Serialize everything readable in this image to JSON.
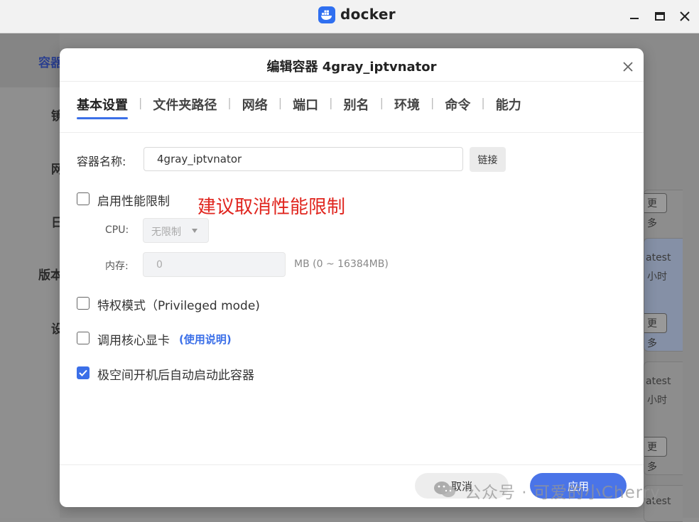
{
  "window": {
    "title": "docker",
    "controls": [
      "minimize-icon",
      "maximize-icon",
      "close-icon"
    ]
  },
  "background": {
    "sidebar_items": [
      "容器",
      "镜",
      "网",
      "日",
      "版本",
      "设"
    ],
    "cards": [
      {
        "lines": [],
        "button": "更多"
      },
      {
        "lines": [
          "atest",
          "小时"
        ],
        "button": "更多"
      },
      {
        "lines": [
          "atest",
          "小时"
        ],
        "button": "更多"
      },
      {
        "lines": [
          "atest"
        ],
        "button": ""
      }
    ]
  },
  "dialog": {
    "title": "编辑容器 4gray_iptvnator",
    "tabs": [
      "基本设置",
      "文件夹路径",
      "网络",
      "端口",
      "别名",
      "环境",
      "命令",
      "能力"
    ],
    "active_tab": 0,
    "container_name": {
      "label": "容器名称:",
      "value": "4gray_iptvnator",
      "link_button": "链接"
    },
    "perf_limit": {
      "label": "启用性能限制",
      "checked": false,
      "annotation": "建议取消性能限制",
      "cpu_label": "CPU:",
      "cpu_value": "无限制",
      "mem_label": "内存:",
      "mem_value": "0",
      "mem_hint": "MB (0 ~ 16384MB)"
    },
    "privileged": {
      "label": "特权模式（Privileged mode)",
      "checked": false
    },
    "gpu": {
      "label": "调用核心显卡",
      "link": "(使用说明)",
      "checked": false
    },
    "autostart": {
      "label": "极空间开机后自动启动此容器",
      "checked": true
    },
    "buttons": {
      "cancel": "取消",
      "apply": "应用"
    }
  },
  "watermark": {
    "text": "公众号 · 可爱的小Cherry",
    "icon": "wechat-icon"
  },
  "colors": {
    "accent": "#3b6fe8",
    "annotation": "#e0261f",
    "docker_blue": "#2f6ff0"
  }
}
